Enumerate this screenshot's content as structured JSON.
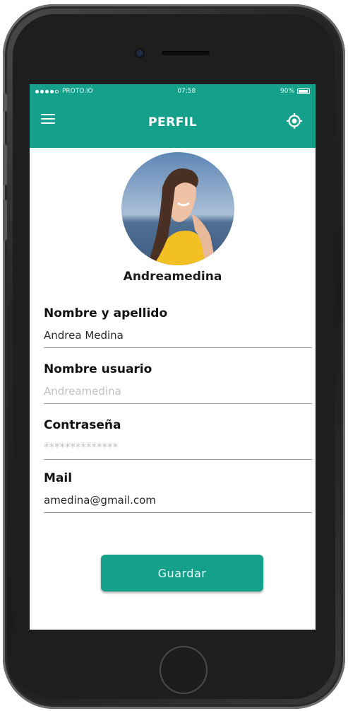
{
  "status_bar": {
    "carrier": "PROTO.IO",
    "time": "07:58",
    "battery_percent": "90%",
    "battery_level": 0.9
  },
  "app_bar": {
    "title": "PERFIL",
    "menu_icon": "hamburger-menu-icon",
    "action_icon": "location-target-icon"
  },
  "profile": {
    "avatar_icon": "user-photo",
    "username": "Andreamedina"
  },
  "form": {
    "fields": [
      {
        "label": "Nombre y apellido",
        "value": "Andrea Medina",
        "placeholder": ""
      },
      {
        "label": "Nombre usuario",
        "value": "",
        "placeholder": "Andreamedina"
      },
      {
        "label": "Contraseña",
        "value": "",
        "placeholder": "**************"
      },
      {
        "label": "Mail",
        "value": "amedina@gmail.com",
        "placeholder": ""
      }
    ],
    "save_label": "Guardar"
  },
  "colors": {
    "accent": "#14a08a",
    "phone_body": "#1e1e1e"
  }
}
